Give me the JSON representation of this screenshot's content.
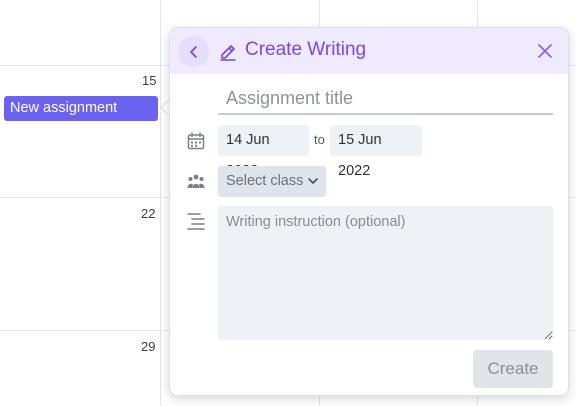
{
  "calendar": {
    "day_numbers": [
      "15",
      "22",
      "29"
    ],
    "event_label": "New assignment"
  },
  "popup": {
    "title": "Create Writing",
    "title_placeholder": "Assignment title",
    "start_date": "14 Jun 2022",
    "date_separator": "to",
    "end_date": "15 Jun 2022",
    "class_select_label": "Select class",
    "instruction_placeholder": "Writing instruction (optional)",
    "create_label": "Create",
    "accent_color": "#7b46e4",
    "header_bg": "#efeafd"
  },
  "icons": [
    "chevron-left-icon",
    "pencil-icon",
    "close-icon",
    "calendar-icon",
    "people-icon",
    "chevron-down-icon",
    "align-right-icon"
  ]
}
